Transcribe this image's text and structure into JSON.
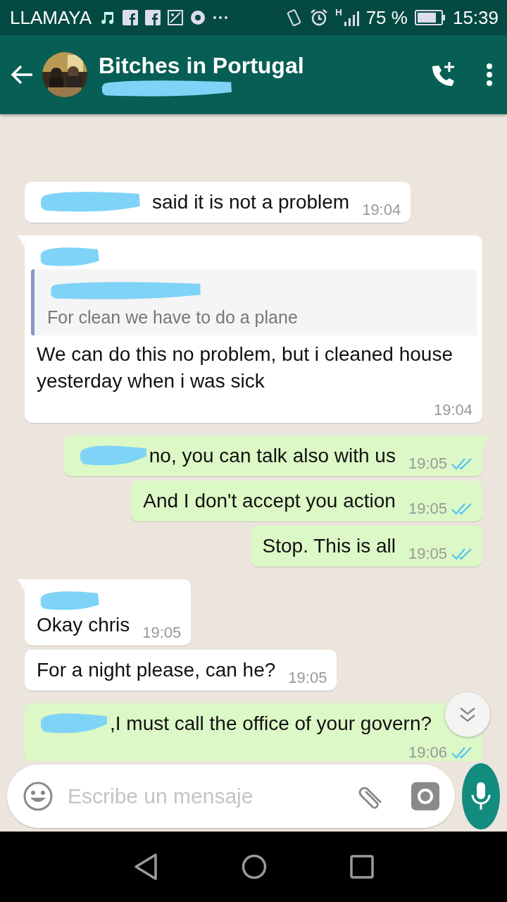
{
  "status_bar": {
    "carrier": "LLAMAYA",
    "battery": "75 %",
    "time": "15:39"
  },
  "header": {
    "title": "Bitches in Portugal",
    "subtitle_redacted": true
  },
  "messages": [
    {
      "kind": "incoming",
      "first_in_group": false,
      "sender_redacted": false,
      "text_redacted": true,
      "text": "said it is not a problem",
      "time": "19:04"
    },
    {
      "kind": "incoming",
      "first_in_group": true,
      "sender_redacted": true,
      "quote": {
        "author_redacted": true,
        "text": "For clean we have to do a plane"
      },
      "text_redacted": false,
      "text": "We can do this no problem, but i cleaned house yesterday when i was sick",
      "time": "19:04"
    },
    {
      "kind": "outgoing",
      "first_in_group": true,
      "text_redacted": true,
      "text": "no, you can talk also with us",
      "time": "19:05",
      "read": true
    },
    {
      "kind": "outgoing",
      "first_in_group": false,
      "text_redacted": false,
      "text": "And I don't accept you action",
      "time": "19:05",
      "read": true
    },
    {
      "kind": "outgoing",
      "first_in_group": false,
      "text_redacted": false,
      "text": "Stop. This is all",
      "time": "19:05",
      "read": true
    },
    {
      "kind": "incoming",
      "first_in_group": true,
      "sender_redacted": true,
      "text_redacted": false,
      "text": "Okay chris",
      "time": "19:05"
    },
    {
      "kind": "incoming",
      "first_in_group": false,
      "sender_redacted": false,
      "text_redacted": false,
      "text": "For a night please, can he?",
      "time": "19:05"
    },
    {
      "kind": "outgoing",
      "first_in_group": true,
      "text_redacted": true,
      "text": ",I must call the office of your govern?",
      "time": "19:06",
      "read": true
    }
  ],
  "composer": {
    "placeholder": "Escribe un mensaje"
  }
}
